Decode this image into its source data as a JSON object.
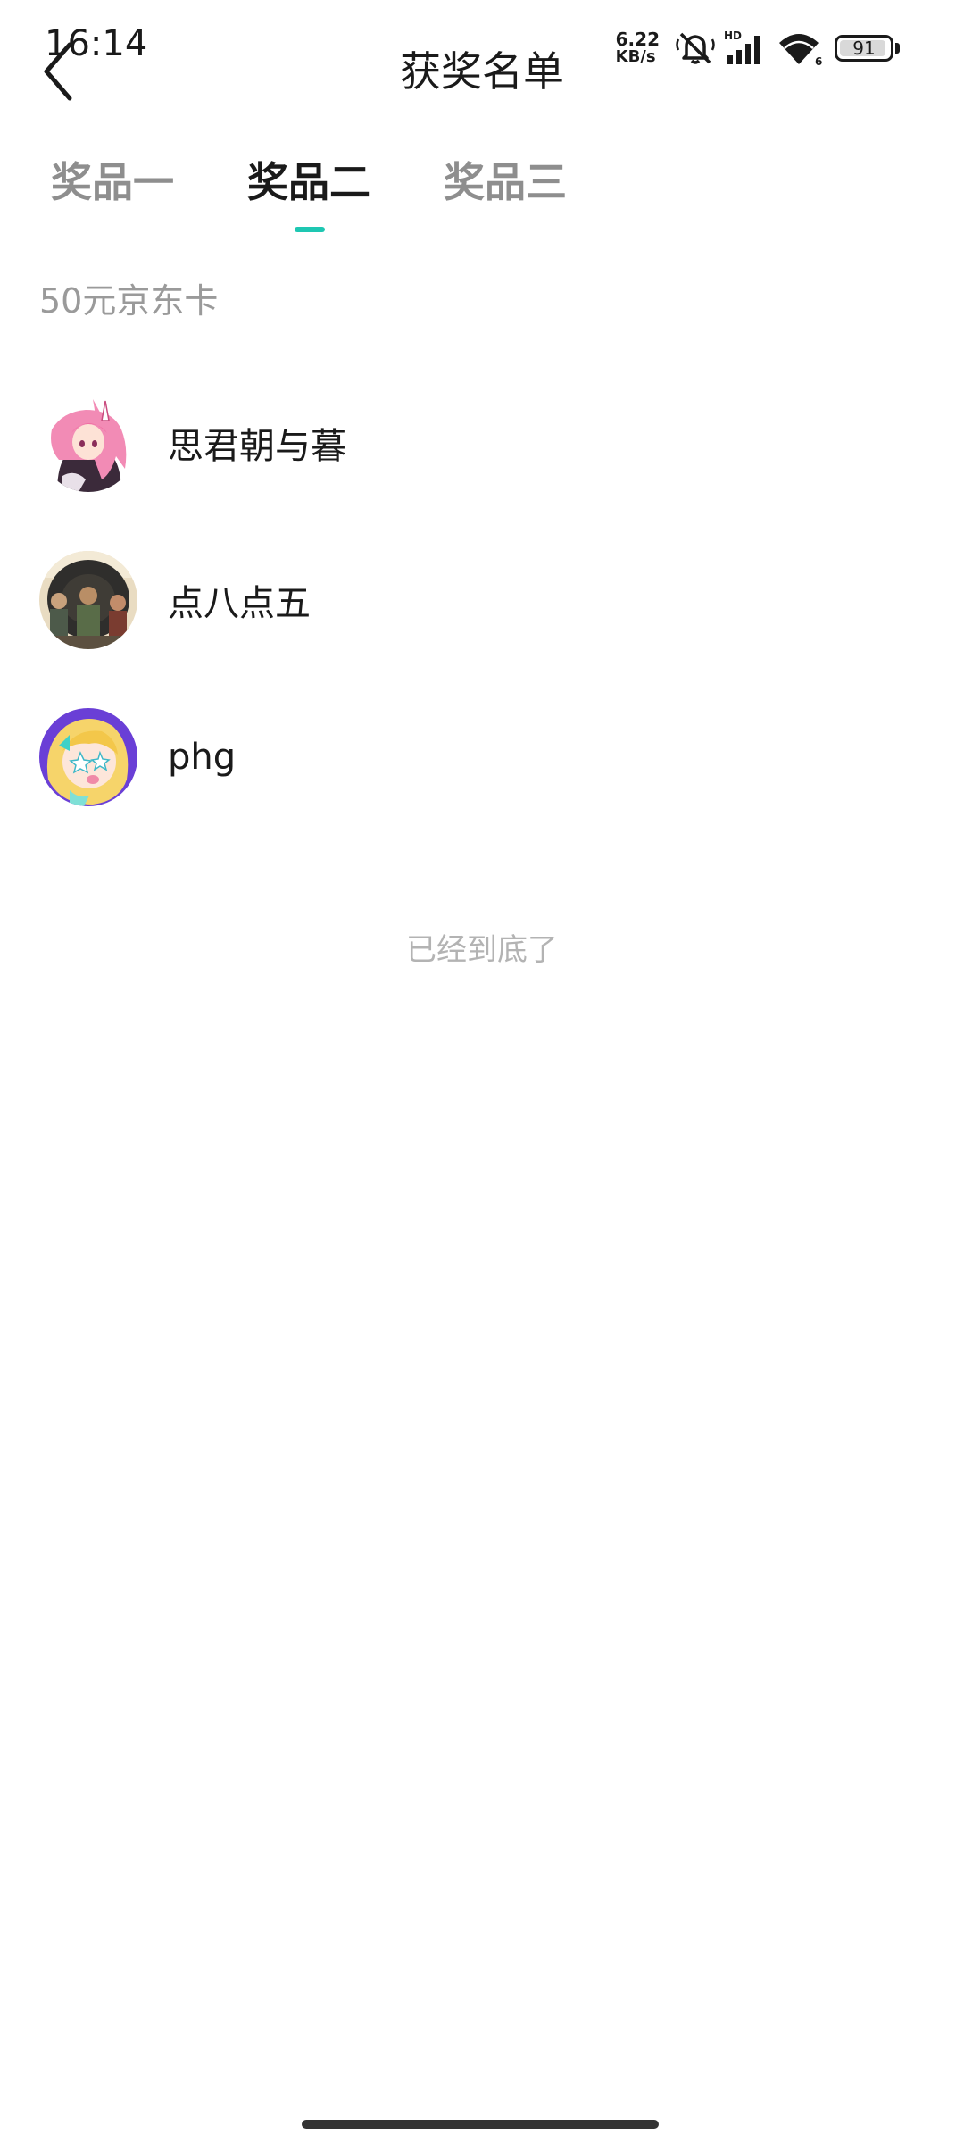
{
  "status_bar": {
    "time": "16:14",
    "net_speed_value": "6.22",
    "net_speed_unit": "KB/s",
    "network_label": "HD",
    "wifi_label": "6",
    "battery_level": "91",
    "icons": [
      "mute-bell-icon",
      "cellular-signal-icon",
      "wifi-icon",
      "battery-icon"
    ]
  },
  "header": {
    "title": "获奖名单",
    "back_icon": "back-arrow-icon"
  },
  "tabs": [
    {
      "label": "奖品一",
      "active": false
    },
    {
      "label": "奖品二",
      "active": true
    },
    {
      "label": "奖品三",
      "active": false
    }
  ],
  "prize_name": "50元京东卡",
  "winners": [
    {
      "name": "思君朝与暮",
      "avatar": "anime-girl-pink-hair-avatar"
    },
    {
      "name": "点八点五",
      "avatar": "three-figures-photo-avatar"
    },
    {
      "name": "phg",
      "avatar": "cartoon-blonde-character-avatar"
    }
  ],
  "end_text": "已经到底了",
  "colors": {
    "accent": "#1ec7b2",
    "text_primary": "#1a1a1a",
    "text_secondary": "#9a9a9a",
    "end_text": "#b3b3b3",
    "background": "#ffffff"
  }
}
